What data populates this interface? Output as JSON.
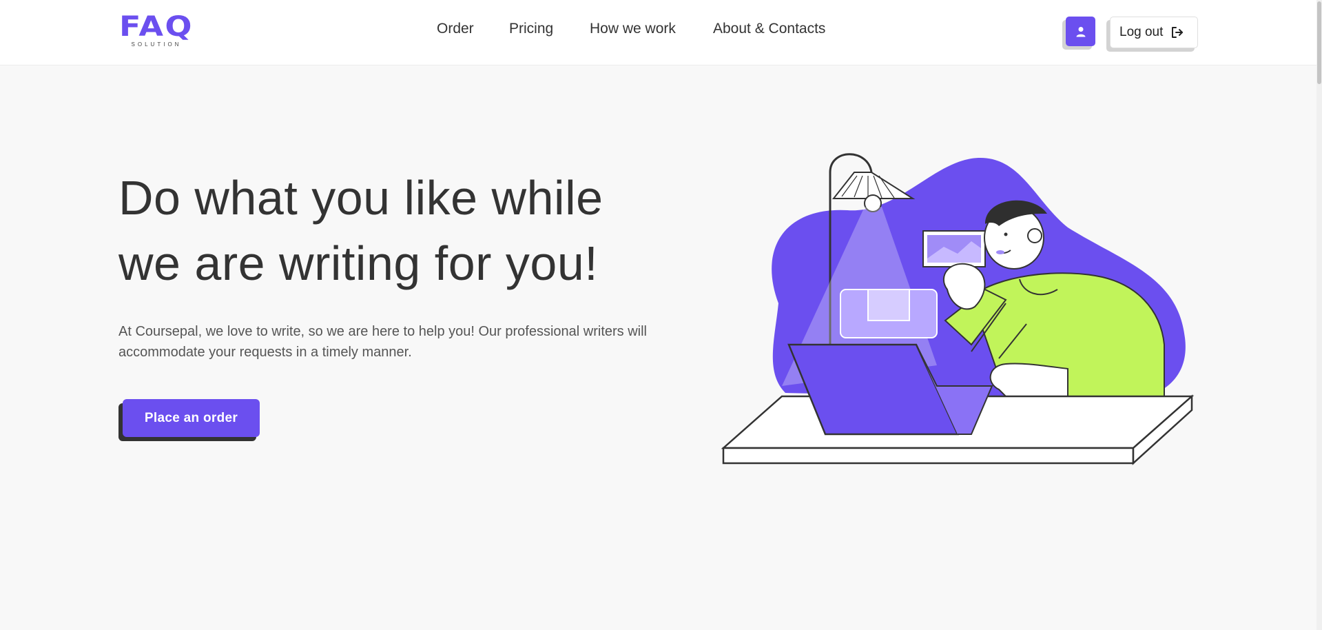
{
  "brand": {
    "logo_main": "FAQ",
    "logo_sub": "SOLUTION",
    "accent_color": "#6b4fef",
    "highlight_color": "#c1f45a"
  },
  "nav": {
    "items": [
      {
        "label": "Order"
      },
      {
        "label": "Pricing"
      },
      {
        "label": "How we work"
      },
      {
        "label": "About & Contacts"
      }
    ]
  },
  "header": {
    "profile_icon": "user-icon",
    "logout_label": "Log out",
    "logout_icon": "logout-icon"
  },
  "hero": {
    "title_line1": "Do what you like while",
    "title_line2": "we are writing for you!",
    "description_line1": "At Coursepal, we love to write, so we are here to help you! Our professional writers will",
    "description_line2": "accommodate your requests in a timely manner.",
    "cta_label": "Place an order"
  }
}
